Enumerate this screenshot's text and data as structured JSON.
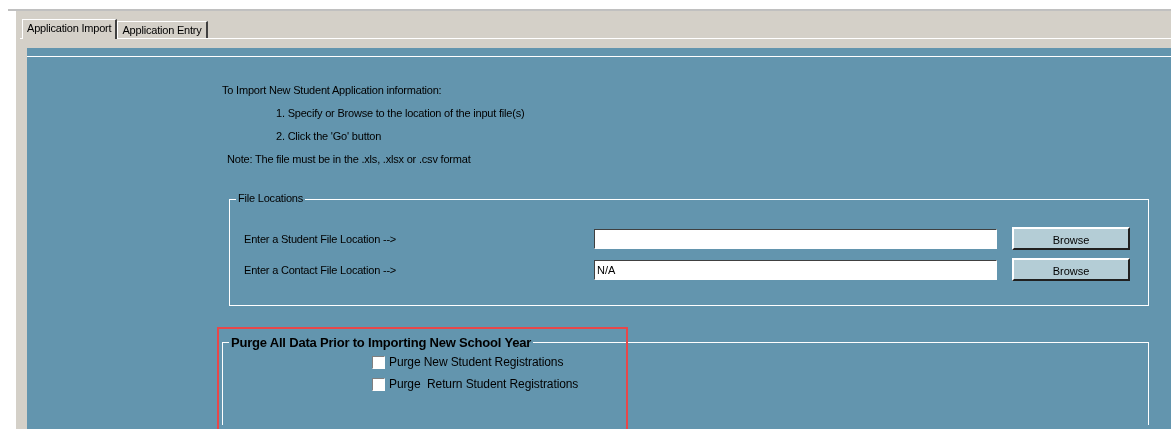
{
  "tabs": [
    {
      "label": "Application Import",
      "selected": true
    },
    {
      "label": "Application Entry",
      "selected": false
    }
  ],
  "instructions": {
    "heading": "To Import New Student Application information:",
    "steps": [
      "1.  Specify or Browse to the location of the input file(s)",
      "2.  Click the 'Go' button"
    ],
    "note": "Note:  The file must be in the .xls, .xlsx or .csv format"
  },
  "file_locations": {
    "title": "File Locations",
    "rows": [
      {
        "label": "Enter a Student File Location -->",
        "value": "",
        "button": "Browse"
      },
      {
        "label": "Enter a Contact File Location -->",
        "value": "N/A",
        "button": "Browse"
      }
    ]
  },
  "purge": {
    "title": "Purge All Data Prior to Importing New School Year",
    "highlighted": true,
    "options": [
      {
        "label": "Purge New Student Registrations",
        "checked": false
      },
      {
        "label": "Purge  Return Student Registrations",
        "checked": false
      }
    ]
  }
}
